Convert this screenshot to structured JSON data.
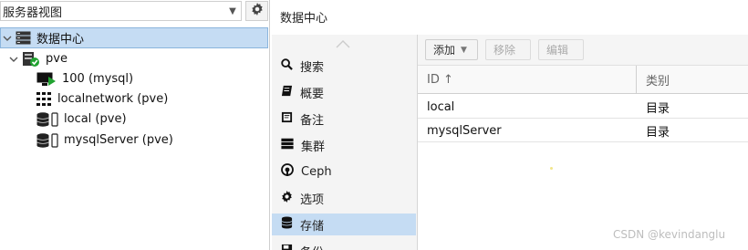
{
  "left_panel": {
    "view_select": {
      "value": "服务器视图"
    },
    "tree": {
      "datacenter": {
        "label": "数据中心"
      },
      "node": {
        "label": "pve"
      },
      "items": [
        {
          "label": "100 (mysql)",
          "icon": "vm-running-icon"
        },
        {
          "label": "localnetwork (pve)",
          "icon": "network-grid-icon"
        },
        {
          "label": "local (pve)",
          "icon": "storage-icon"
        },
        {
          "label": "mysqlServer (pve)",
          "icon": "storage-icon"
        }
      ]
    }
  },
  "header": {
    "title": "数据中心"
  },
  "nav": {
    "items": [
      {
        "label": "搜索",
        "icon": "search-icon"
      },
      {
        "label": "概要",
        "icon": "book-icon"
      },
      {
        "label": "备注",
        "icon": "note-icon"
      },
      {
        "label": "集群",
        "icon": "server-rack-icon"
      },
      {
        "label": "Ceph",
        "icon": "ceph-icon"
      },
      {
        "label": "选项",
        "icon": "gear-icon"
      },
      {
        "label": "存储",
        "icon": "database-icon",
        "active": true
      },
      {
        "label": "备份",
        "icon": "backup-icon"
      }
    ]
  },
  "toolbar": {
    "add_label": "添加",
    "remove_label": "移除",
    "edit_label": "编辑"
  },
  "grid": {
    "columns": {
      "id": "ID ↑",
      "type": "类别"
    },
    "rows": [
      {
        "id": "local",
        "type": "目录"
      },
      {
        "id": "mysqlServer",
        "type": "目录"
      }
    ]
  },
  "watermark": "CSDN @kevindanglu",
  "colors": {
    "selection": "#c5dcf3",
    "selection_border": "#8bb5dd",
    "vm_running": "#21a331"
  }
}
